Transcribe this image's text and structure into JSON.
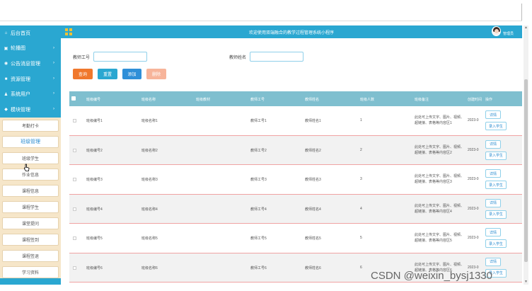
{
  "header": {
    "title": "欢迎使用双端融合的教学过程管理系统小程序",
    "username": "管理员"
  },
  "sidebar": {
    "items": [
      {
        "label": "后台首页",
        "icon": "home-icon",
        "chevron": false
      },
      {
        "label": "轮播图",
        "icon": "image-icon",
        "chevron": true
      },
      {
        "label": "公告消息管理",
        "icon": "bell-icon",
        "chevron": true
      },
      {
        "label": "资源管理",
        "icon": "folder-icon",
        "chevron": true
      },
      {
        "label": "系统用户",
        "icon": "user-icon",
        "chevron": true
      },
      {
        "label": "模块管理",
        "icon": "module-icon",
        "chevron": true
      }
    ],
    "submenu": [
      "考勤打卡",
      "班级管理",
      "班级学生",
      "作业信息",
      "课程信息",
      "课程学生",
      "课堂提问",
      "课程签到",
      "课程签退",
      "学习资料"
    ]
  },
  "search": {
    "field1_label": "教师工号",
    "field1_value": "",
    "field2_label": "教师姓名",
    "field2_value": ""
  },
  "buttons": {
    "search": "查询",
    "reset": "重置",
    "add": "添加",
    "delete": "删除"
  },
  "table": {
    "columns": [
      "班级编号",
      "班级名称",
      "班级教材",
      "教师工号",
      "教师姓名",
      "班级人数",
      "班级备注",
      "创建时间",
      "操作"
    ],
    "rows": [
      {
        "code": "班级编号1",
        "name": "班级名称1",
        "material": "",
        "tno": "教师工号1",
        "tname": "教师姓名1",
        "count": "1",
        "note": "此处可上传文字、图片、视频、超链接、表格等内容区1",
        "date": "2023-0"
      },
      {
        "code": "班级编号2",
        "name": "班级名称2",
        "material": "",
        "tno": "教师工号2",
        "tname": "教师姓名2",
        "count": "2",
        "note": "此处可上传文字、图片、视频、超链接、表格等内容区2",
        "date": "2023-0"
      },
      {
        "code": "班级编号3",
        "name": "班级名称3",
        "material": "",
        "tno": "教师工号3",
        "tname": "教师姓名3",
        "count": "3",
        "note": "此处可上传文字、图片、视频、超链接、表格等内容区3",
        "date": "2023-0"
      },
      {
        "code": "班级编号4",
        "name": "班级名称4",
        "material": "",
        "tno": "教师工号4",
        "tname": "教师姓名4",
        "count": "4",
        "note": "此处可上传文字、图片、视频、超链接、表格等内容区4",
        "date": "2023-0"
      },
      {
        "code": "班级编号5",
        "name": "班级名称5",
        "material": "",
        "tno": "教师工号5",
        "tname": "教师姓名5",
        "count": "5",
        "note": "此处可上传文字、图片、视频、超链接、表格等内容区5",
        "date": "2023-0"
      },
      {
        "code": "班级编号6",
        "name": "班级名称6",
        "material": "",
        "tno": "教师工号6",
        "tname": "教师姓名6",
        "count": "6",
        "note": "此处可上传文字、图片、视频、超链接、表格等内容区6",
        "date": "2023-0"
      }
    ],
    "action_detail": "详情",
    "action_enroll": "录入学生"
  },
  "watermark": "CSDN @weixin_bysj1330",
  "colors": {
    "primary": "#2aa7d1",
    "submenu_bg": "#f6e6c9",
    "search_btn": "#f0782d",
    "add_btn": "#2f8fd8",
    "delete_btn": "#f7b49a",
    "table_header": "#7fbfcf"
  }
}
